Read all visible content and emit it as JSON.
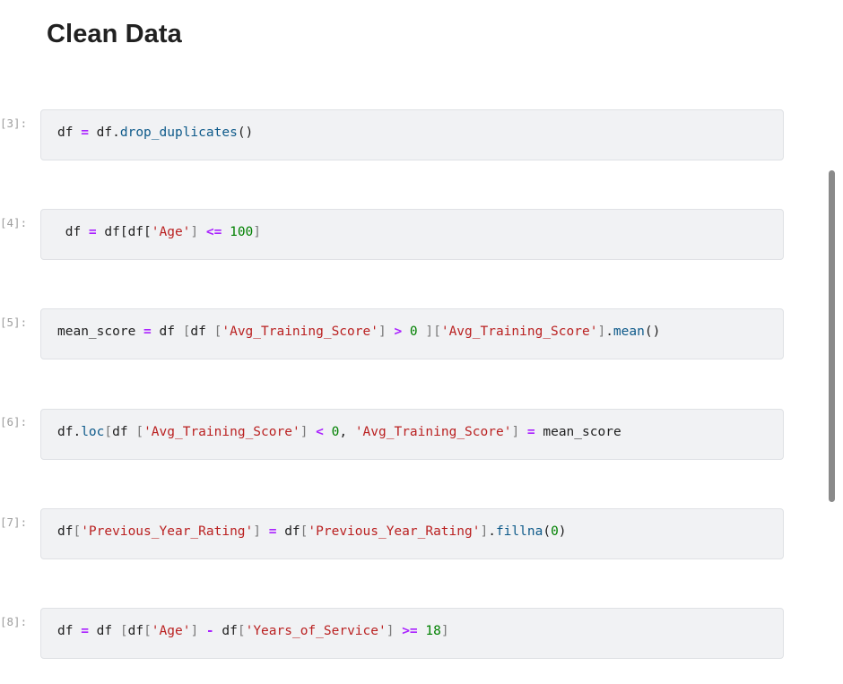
{
  "heading": "Clean Data",
  "cells": [
    {
      "prompt": "[3]:",
      "tokens": [
        {
          "t": "df ",
          "c": ""
        },
        {
          "t": "=",
          "c": "op"
        },
        {
          "t": " df.",
          "c": ""
        },
        {
          "t": "drop_duplicates",
          "c": "fn"
        },
        {
          "t": "()",
          "c": ""
        }
      ]
    },
    {
      "prompt": "[4]:",
      "tokens": [
        {
          "t": " df ",
          "c": ""
        },
        {
          "t": "=",
          "c": "op"
        },
        {
          "t": " df[df[",
          "c": ""
        },
        {
          "t": "'Age'",
          "c": "str"
        },
        {
          "t": "]",
          "c": "br"
        },
        {
          "t": " ",
          "c": ""
        },
        {
          "t": "<=",
          "c": "op"
        },
        {
          "t": " ",
          "c": ""
        },
        {
          "t": "100",
          "c": "num"
        },
        {
          "t": "]",
          "c": "br"
        }
      ]
    },
    {
      "prompt": "[5]:",
      "tokens": [
        {
          "t": "mean_score ",
          "c": ""
        },
        {
          "t": "=",
          "c": "op"
        },
        {
          "t": " df ",
          "c": ""
        },
        {
          "t": "[",
          "c": "br"
        },
        {
          "t": "df ",
          "c": ""
        },
        {
          "t": "[",
          "c": "br"
        },
        {
          "t": "'Avg_Training_Score'",
          "c": "str"
        },
        {
          "t": "]",
          "c": "br"
        },
        {
          "t": " ",
          "c": ""
        },
        {
          "t": ">",
          "c": "op"
        },
        {
          "t": " ",
          "c": ""
        },
        {
          "t": "0",
          "c": "num"
        },
        {
          "t": " ",
          "c": ""
        },
        {
          "t": "][",
          "c": "br"
        },
        {
          "t": "'Avg_Training_Score'",
          "c": "str"
        },
        {
          "t": "]",
          "c": "br"
        },
        {
          "t": ".",
          "c": ""
        },
        {
          "t": "mean",
          "c": "fn"
        },
        {
          "t": "()",
          "c": ""
        }
      ]
    },
    {
      "prompt": "[6]:",
      "tokens": [
        {
          "t": "df.",
          "c": ""
        },
        {
          "t": "loc",
          "c": "fn"
        },
        {
          "t": "[",
          "c": "br"
        },
        {
          "t": "df ",
          "c": ""
        },
        {
          "t": "[",
          "c": "br"
        },
        {
          "t": "'Avg_Training_Score'",
          "c": "str"
        },
        {
          "t": "]",
          "c": "br"
        },
        {
          "t": " ",
          "c": ""
        },
        {
          "t": "<",
          "c": "op"
        },
        {
          "t": " ",
          "c": ""
        },
        {
          "t": "0",
          "c": "num"
        },
        {
          "t": ", ",
          "c": ""
        },
        {
          "t": "'Avg_Training_Score'",
          "c": "str"
        },
        {
          "t": "]",
          "c": "br"
        },
        {
          "t": " ",
          "c": ""
        },
        {
          "t": "=",
          "c": "op"
        },
        {
          "t": " mean_score",
          "c": ""
        }
      ]
    },
    {
      "prompt": "[7]:",
      "tokens": [
        {
          "t": "df",
          "c": ""
        },
        {
          "t": "[",
          "c": "br"
        },
        {
          "t": "'Previous_Year_Rating'",
          "c": "str"
        },
        {
          "t": "]",
          "c": "br"
        },
        {
          "t": " ",
          "c": ""
        },
        {
          "t": "=",
          "c": "op"
        },
        {
          "t": " df",
          "c": ""
        },
        {
          "t": "[",
          "c": "br"
        },
        {
          "t": "'Previous_Year_Rating'",
          "c": "str"
        },
        {
          "t": "]",
          "c": "br"
        },
        {
          "t": ".",
          "c": ""
        },
        {
          "t": "fillna",
          "c": "fn"
        },
        {
          "t": "(",
          "c": ""
        },
        {
          "t": "0",
          "c": "num"
        },
        {
          "t": ")",
          "c": ""
        }
      ]
    },
    {
      "prompt": "[8]:",
      "tokens": [
        {
          "t": "df ",
          "c": ""
        },
        {
          "t": "=",
          "c": "op"
        },
        {
          "t": " df ",
          "c": ""
        },
        {
          "t": "[",
          "c": "br"
        },
        {
          "t": "df",
          "c": ""
        },
        {
          "t": "[",
          "c": "br"
        },
        {
          "t": "'Age'",
          "c": "str"
        },
        {
          "t": "]",
          "c": "br"
        },
        {
          "t": " ",
          "c": ""
        },
        {
          "t": "-",
          "c": "op"
        },
        {
          "t": " df",
          "c": ""
        },
        {
          "t": "[",
          "c": "br"
        },
        {
          "t": "'Years_of_Service'",
          "c": "str"
        },
        {
          "t": "]",
          "c": "br"
        },
        {
          "t": " ",
          "c": ""
        },
        {
          "t": ">=",
          "c": "op"
        },
        {
          "t": " ",
          "c": ""
        },
        {
          "t": "18",
          "c": "num"
        },
        {
          "t": "]",
          "c": "br"
        }
      ]
    }
  ]
}
